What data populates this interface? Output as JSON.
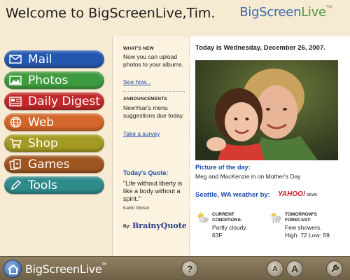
{
  "header": {
    "welcome": "Welcome to BigScreenLive,Tim.",
    "logo_part1": "BigScreen",
    "logo_part2": "Live",
    "logo_tm": "TM"
  },
  "nav": [
    {
      "label": "Mail",
      "icon": "mail-icon",
      "color": "#2457b0"
    },
    {
      "label": "Photos",
      "icon": "photos-icon",
      "color": "#3f9b3f"
    },
    {
      "label": "Daily Digest",
      "icon": "newspaper-icon",
      "color": "#c0282b"
    },
    {
      "label": "Web",
      "icon": "globe-icon",
      "color": "#d4662a"
    },
    {
      "label": "Shop",
      "icon": "cart-icon",
      "color": "#a49a23"
    },
    {
      "label": "Games",
      "icon": "cards-icon",
      "color": "#9e5520"
    },
    {
      "label": "Tools",
      "icon": "pencil-icon",
      "color": "#2f8a8a"
    }
  ],
  "whats_new": {
    "title": "WHAT'S NEW",
    "text": "Now you can upload photos to your albums.",
    "link": "See how..."
  },
  "announcements": {
    "title": "ANNOUNCEMENTS",
    "text": "NewYear's menu suggestions due today.",
    "link": "Take a survey"
  },
  "quote": {
    "title": "Today's Quote:",
    "text": "\"Life without liberty is like a body without a spirit.\"",
    "author": "Kahlil Gibran",
    "by": "By:",
    "source": "BrainyQuote"
  },
  "today": "Today is Wednesday, December 26, 2007.",
  "photo_of_day": {
    "title": "Picture of the day:",
    "caption": "Meg and MacKenzie in on Mother's Day"
  },
  "weather": {
    "title": "Seattle, WA weather by:",
    "provider": "YAHOO!",
    "provider_suffix": "NEWS",
    "current_label_1": "CURRENT",
    "current_label_2": "CONDITIONS:",
    "current_text": "Partly cloudy.",
    "current_temp": "63F",
    "forecast_label_1": "TOMORROW'S",
    "forecast_label_2": "FORECAST:",
    "forecast_text": "Few showers.",
    "forecast_temps": "High: 72 Low: 59"
  },
  "footer": {
    "logo_part1": "BigScreen",
    "logo_part2": "Live",
    "logo_tm": "TM",
    "help": "?",
    "font_small": "A",
    "font_large": "A"
  }
}
